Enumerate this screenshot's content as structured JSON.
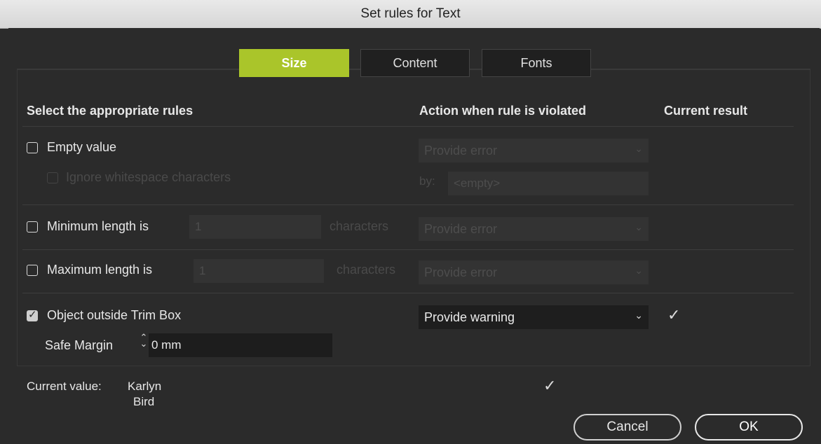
{
  "window": {
    "title": "Set rules for Text"
  },
  "tabs": [
    {
      "label": "Size",
      "active": true
    },
    {
      "label": "Content",
      "active": false
    },
    {
      "label": "Fonts",
      "active": false
    }
  ],
  "headers": {
    "rules": "Select the appropriate rules",
    "action": "Action when rule is violated",
    "result": "Current result"
  },
  "rules": {
    "empty": {
      "label": "Empty value",
      "checked": false,
      "action": "Provide error"
    },
    "ignore_ws": {
      "label": "Ignore whitespace characters",
      "checked": false
    },
    "by": {
      "label": "by:",
      "value": "<empty>"
    },
    "min_length": {
      "label": "Minimum length is",
      "value": "1",
      "unit": "characters",
      "action": "Provide error",
      "checked": false
    },
    "max_length": {
      "label": "Maximum length is",
      "value": "1",
      "unit": "characters",
      "action": "Provide error",
      "checked": false
    },
    "trim_box": {
      "label": "Object outside Trim Box",
      "checked": true,
      "action": "Provide warning",
      "result": "✓"
    },
    "safe_margin": {
      "label": "Safe Margin",
      "value": "0 mm"
    }
  },
  "current_value": {
    "label": "Current value:",
    "line1": "Karlyn",
    "line2": "Bird",
    "result": "✓"
  },
  "buttons": {
    "cancel": "Cancel",
    "ok": "OK"
  },
  "icons": {
    "chevron": "⌄",
    "stepper": "⌃⌄"
  },
  "colors": {
    "accent": "#aac52a",
    "background": "#2b2b2b"
  }
}
